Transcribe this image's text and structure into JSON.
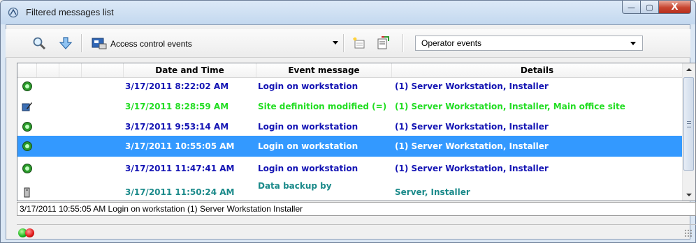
{
  "window": {
    "title": "Filtered messages list",
    "title_icon": "app-logo-icon",
    "controls": {
      "minimize": "—",
      "maximize": "▢",
      "close": "X"
    }
  },
  "toolbar": {
    "search_icon": "magnifier-icon",
    "scroll_icon": "down-arrow-icon",
    "combo1_value": "Access control events",
    "combo2_value": "Operator events",
    "new_icon": "new-item-icon",
    "export_icon": "export-icon"
  },
  "table": {
    "columns": [
      "Date and Time",
      "Event message",
      "Details"
    ],
    "rows": [
      {
        "icon": "workstation-login-icon",
        "date": "3/17/2011 8:22:02 AM",
        "message": "Login on workstation",
        "details": "(1)  Server Workstation, Installer",
        "color": "#1414b4",
        "selected": false
      },
      {
        "icon": "edit-site-icon",
        "date": "3/17/2011 8:28:59 AM",
        "message": "Site definition modified (=)",
        "details": "(1)  Server Workstation, Installer, Main office site",
        "color": "#22dd22",
        "selected": false
      },
      {
        "icon": "workstation-login-icon",
        "date": "3/17/2011 9:53:14 AM",
        "message": "Login on workstation",
        "details": "(1)  Server Workstation, Installer",
        "color": "#1414b4",
        "selected": false
      },
      {
        "icon": "workstation-login-icon",
        "date": "3/17/2011 10:55:05 AM",
        "message": "Login on workstation",
        "details": "(1)  Server Workstation, Installer",
        "color": "#1414b4",
        "selected": true
      },
      {
        "icon": "workstation-login-icon",
        "date": "3/17/2011 11:47:41 AM",
        "message": "Login on workstation",
        "details": "(1)  Server Workstation, Installer",
        "color": "#1414b4",
        "selected": false
      },
      {
        "icon": "backup-tower-icon",
        "date": "3/17/2011 11:50:24 AM",
        "message": "Data backup by",
        "details": "Server, Installer",
        "color": "#1b8a8a",
        "selected": false
      }
    ]
  },
  "status_line": "3/17/2011 10:55:05 AM  Login on workstation  (1)  Server Workstation  Installer",
  "bottom": {
    "green_led": "green-led-icon",
    "red_led": "red-led-icon"
  }
}
